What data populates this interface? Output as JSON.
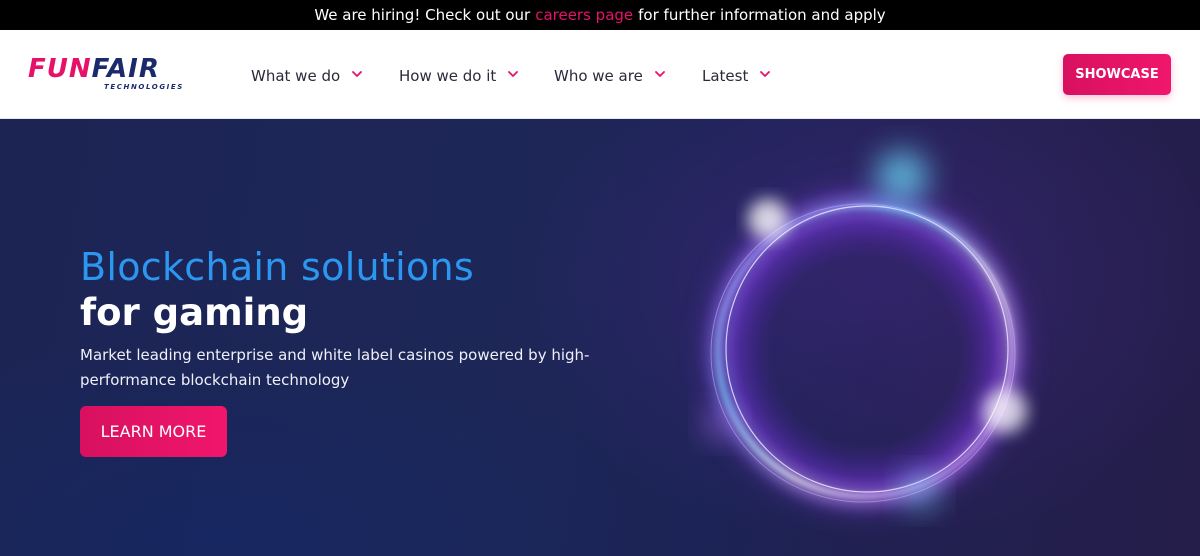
{
  "announcement": {
    "before": "We are hiring! Check out our",
    "link": "careers page",
    "after": "for further information and apply"
  },
  "logo": {
    "main_fun": "FUN",
    "main_fair": "FAIR",
    "sub": "TECHNOLOGIES"
  },
  "nav": {
    "items": [
      {
        "label": "What we do"
      },
      {
        "label": "How we do it"
      },
      {
        "label": "Who we are"
      },
      {
        "label": "Latest"
      }
    ],
    "showcase_label": "SHOWCASE"
  },
  "hero": {
    "title_line1": "Blockchain solutions",
    "title_line2": "for gaming",
    "description": "Market leading enterprise and white label casinos powered by high-performance blockchain technology",
    "cta_label": "LEARN MORE"
  },
  "colors": {
    "brand_pink": "#e8116a",
    "brand_navy": "#1a2a6c",
    "hero_blue_text": "#2c97f0",
    "hero_bg": "#1c2454"
  },
  "icons": {
    "nav_chevron": "chevron-down-icon",
    "hero_graphic": "glowing-ring-graphic"
  }
}
